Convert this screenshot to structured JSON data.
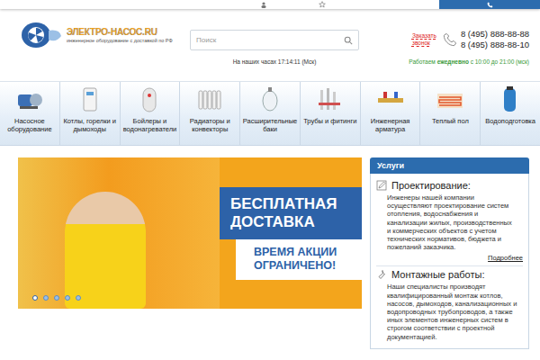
{
  "logo": {
    "name": "ЭЛЕКТРО-НАСОС.RU",
    "tagline": "инженерное оборудование с доставкой по РФ"
  },
  "search": {
    "placeholder": "Поиск"
  },
  "clock": "На наших часах 17:14:11 (Мск)",
  "contacts": {
    "callback": "Заказать звонок",
    "phones": [
      "8 (495) 888-88-88",
      "8 (495) 888-88-10"
    ],
    "hours": {
      "prefix": "Работаем",
      "days": "ежедневно",
      "suffix": "с 10:00 до 21:00 (мск)"
    }
  },
  "categories": [
    {
      "label": "Насосное оборудование",
      "kind": "pump"
    },
    {
      "label": "Котлы, горелки и дымоходы",
      "kind": "boiler"
    },
    {
      "label": "Бойлеры и водонагреватели",
      "kind": "heater"
    },
    {
      "label": "Радиаторы и конвекторы",
      "kind": "radiator"
    },
    {
      "label": "Расширительные баки",
      "kind": "tank"
    },
    {
      "label": "Трубы и фитинги",
      "kind": "pipes"
    },
    {
      "label": "Инженерная арматура",
      "kind": "valves"
    },
    {
      "label": "Теплый пол",
      "kind": "floor"
    },
    {
      "label": "Водоподготовка",
      "kind": "water"
    }
  ],
  "banner": {
    "title": "БЕСПЛАТНАЯ ДОСТАВКА",
    "subtitle": "ВРЕМЯ АКЦИИ ОГРАНИЧЕНО!",
    "slides": [
      {
        "selected": true
      },
      {
        "selected": false
      },
      {
        "selected": false
      },
      {
        "selected": false
      },
      {
        "selected": false
      }
    ]
  },
  "services": {
    "title": "Услуги",
    "items": [
      {
        "title": "Проектирование:",
        "kind": "design",
        "text": "Инженеры нашей компании осуществляют проектирование систем отопления, водоснабжения и канализации жилых, производственных и коммерческих объектов с учетом технических нормативов, бюджета и пожеланий заказчика.",
        "more": "Подробнее"
      },
      {
        "title": "Монтажные работы:",
        "kind": "install",
        "text": "Наши специалисты производят квалифицированный монтаж котлов, насосов, дымоходов, канализационных и водопроводных трубопроводов, а также иных элементов инженерных систем в строгом соответствии с проектной документацией.",
        "more": ""
      }
    ]
  }
}
